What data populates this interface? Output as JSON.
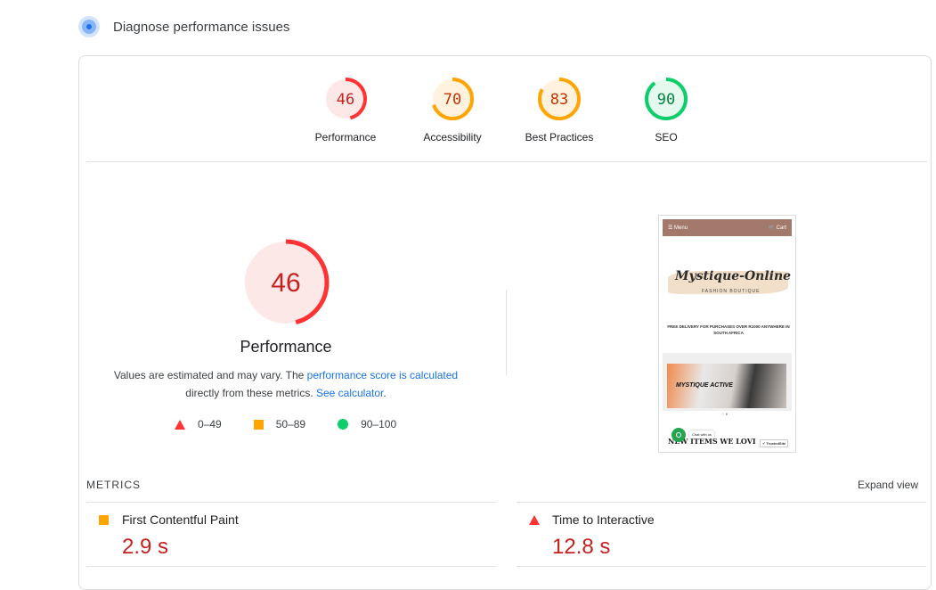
{
  "header": {
    "title": "Diagnose performance issues",
    "icon": "diagnose-icon"
  },
  "scores": [
    {
      "label": "Performance",
      "score": "46",
      "value": 0.46,
      "color": "#ff3333",
      "bg": "#fde8e8",
      "text_color": "#c5221f"
    },
    {
      "label": "Accessibility",
      "score": "70",
      "value": 0.7,
      "color": "#ffa400",
      "bg": "#fff3e0",
      "text_color": "#c33300"
    },
    {
      "label": "Best Practices",
      "score": "83",
      "value": 0.83,
      "color": "#ffa400",
      "bg": "#fff3e0",
      "text_color": "#c33300"
    },
    {
      "label": "SEO",
      "score": "90",
      "value": 0.9,
      "color": "#0cce6b",
      "bg": "#e6f9ee",
      "text_color": "#018642"
    }
  ],
  "main_gauge": {
    "score": "46",
    "value": 0.46,
    "title": "Performance"
  },
  "description": {
    "text_before": "Values are estimated and may vary. The ",
    "link1": "performance score is calculated",
    "text_mid": " directly from these metrics. ",
    "link2": "See calculator",
    "text_after": "."
  },
  "legend": [
    {
      "shape": "triangle-icon",
      "range": "0–49",
      "color": "#ff3333"
    },
    {
      "shape": "square-icon",
      "range": "50–89",
      "color": "#ffa400"
    },
    {
      "shape": "circle-icon",
      "range": "90–100",
      "color": "#0cce6b"
    }
  ],
  "screenshot": {
    "menu": "☰ Menu",
    "cart": "🛒 Cart",
    "logo": "Mystique-Online",
    "logo_sub": "FASHION BOUTIQUE",
    "promo": "FREE DELIVERY FOR PURCHASES OVER R1000 ANYWHERE IN SOUTH AFRICA",
    "banner": "MYSTIQUE ACTIVE",
    "dots": "○ ●",
    "new_items": "NEW ITEMS WE LOVI",
    "chat": "Chat with us",
    "trusted": "✔ TrustedSite"
  },
  "metrics": {
    "label": "METRICS",
    "expand": "Expand view",
    "items": [
      {
        "title": "First Contentful Paint",
        "value": "2.9 s",
        "status": "square-icon",
        "color": "#ffa400"
      },
      {
        "title": "Time to Interactive",
        "value": "12.8 s",
        "status": "triangle-icon",
        "color": "#ff3333"
      }
    ]
  }
}
